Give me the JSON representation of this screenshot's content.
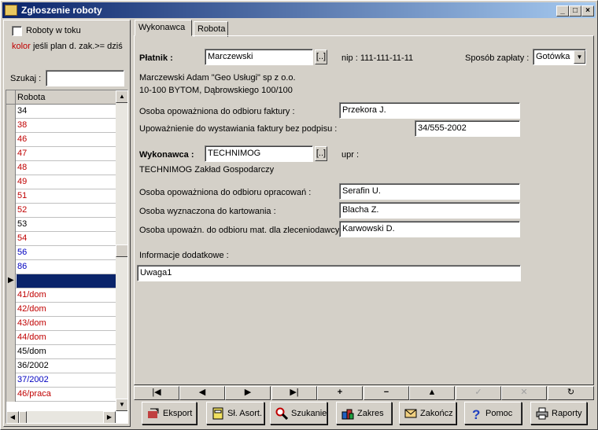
{
  "window": {
    "title": "Zgłoszenie roboty"
  },
  "left": {
    "checkbox_label": "Roboty w toku",
    "kolor_word": "kolor",
    "kolor_rest": "jeśli plan d. zak.>= dziś",
    "search_label": "Szukaj :",
    "search_value": "",
    "column_header": "Robota",
    "rows": [
      {
        "v": "34",
        "c": "black"
      },
      {
        "v": "38",
        "c": "red"
      },
      {
        "v": "46",
        "c": "red"
      },
      {
        "v": "47",
        "c": "red"
      },
      {
        "v": "48",
        "c": "red"
      },
      {
        "v": "49",
        "c": "red"
      },
      {
        "v": "51",
        "c": "red"
      },
      {
        "v": "52",
        "c": "red"
      },
      {
        "v": "53",
        "c": "black"
      },
      {
        "v": "54",
        "c": "red"
      },
      {
        "v": "56",
        "c": "blue"
      },
      {
        "v": "86",
        "c": "blue"
      },
      {
        "v": "",
        "c": "sel"
      },
      {
        "v": "41/dom",
        "c": "red"
      },
      {
        "v": "42/dom",
        "c": "red"
      },
      {
        "v": "43/dom",
        "c": "red"
      },
      {
        "v": "44/dom",
        "c": "red"
      },
      {
        "v": "45/dom",
        "c": "black"
      },
      {
        "v": "36/2002",
        "c": "black"
      },
      {
        "v": "37/2002",
        "c": "blue"
      },
      {
        "v": "46/praca",
        "c": "red"
      }
    ]
  },
  "tabs": [
    {
      "label": "Wykonawca",
      "active": true
    },
    {
      "label": "Robota",
      "active": false
    }
  ],
  "form": {
    "platnik_label": "Płatnik :",
    "platnik_value": "Marczewski",
    "browse": "[..]",
    "nip": "nip : 111-111-11-11",
    "payment_label": "Sposób zapłaty :",
    "payment_value": "Gotówka",
    "payer_name": "Marczewski Adam \"Geo Usługi\" sp z o.o.",
    "payer_address": "10-100 BYTOM, Dąbrowskiego 100/100",
    "invoice_person_label": "Osoba opoważniona do odbioru faktury :",
    "invoice_person_value": "Przekora J.",
    "authorization_label": "Upoważnienie do wystawiania  faktury bez podpisu :",
    "authorization_value": "34/555-2002",
    "wykonawca_label": "Wykonawca :",
    "wykonawca_value": "TECHNIMOG",
    "upr": "upr :",
    "contractor_name": "TECHNIMOG  Zakład Gospodarczy",
    "studies_person_label": "Osoba opoważniona do odbioru opracowań :",
    "studies_person_value": "Serafin U.",
    "mapping_person_label": "Osoba wyznaczona do kartowania :",
    "mapping_person_value": "Blacha Z.",
    "materials_person_label": "Osoba upoważn. do odbioru mat. dla zleceniodawcy :",
    "materials_person_value": "Karwowski D.",
    "info_label": "Informacje dodatkowe :",
    "info_value": "Uwaga1"
  },
  "nav": [
    "|◀",
    "◀",
    "▶",
    "▶|",
    "+",
    "−",
    "▲",
    "✓",
    "✕",
    "↻"
  ],
  "actions": {
    "eksport": "Eksport",
    "sl_asort": "Sł. Asort.",
    "szukanie": "Szukanie",
    "zakres": "Zakres",
    "zakoncz": "Zakończ",
    "pomoc": "Pomoc",
    "raporty": "Raporty"
  }
}
